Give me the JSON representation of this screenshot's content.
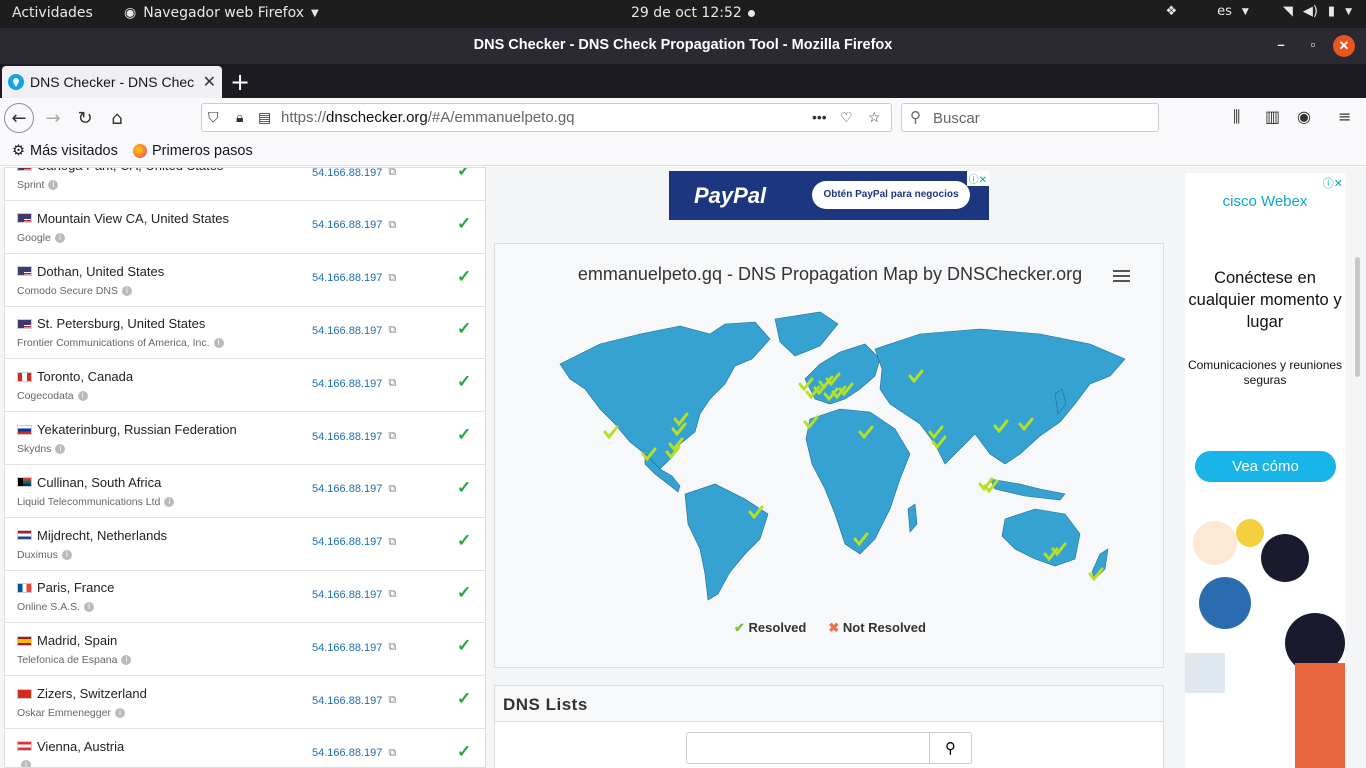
{
  "topbar": {
    "activities": "Actividades",
    "app_name": "Navegador web Firefox",
    "clock": "29 de oct  12:52",
    "lang": "es"
  },
  "window": {
    "title": "DNS Checker - DNS Check Propagation Tool - Mozilla Firefox"
  },
  "tab": {
    "label": "DNS Checker - DNS Chec"
  },
  "urlbar": {
    "prefix": "https://",
    "domain": "dnschecker.org",
    "path": "/#A/emmanuelpeto.gq"
  },
  "search": {
    "placeholder": "Buscar"
  },
  "bookmarks": {
    "most_visited": "Más visitados",
    "getting_started": "Primeros pasos"
  },
  "results": [
    {
      "location": "Canoga Park, CA, United States",
      "provider": "Sprint",
      "ip": "54.166.88.197",
      "flag": "us"
    },
    {
      "location": "Mountain View CA, United States",
      "provider": "Google",
      "ip": "54.166.88.197",
      "flag": "us"
    },
    {
      "location": "Dothan, United States",
      "provider": "Comodo Secure DNS",
      "ip": "54.166.88.197",
      "flag": "us"
    },
    {
      "location": "St. Petersburg, United States",
      "provider": "Frontier Communications of America, Inc.",
      "ip": "54.166.88.197",
      "flag": "us"
    },
    {
      "location": "Toronto, Canada",
      "provider": "Cogecodata",
      "ip": "54.166.88.197",
      "flag": "ca"
    },
    {
      "location": "Yekaterinburg, Russian Federation",
      "provider": "Skydns",
      "ip": "54.166.88.197",
      "flag": "ru"
    },
    {
      "location": "Cullinan, South Africa",
      "provider": "Liquid Telecommunications Ltd",
      "ip": "54.166.88.197",
      "flag": "za"
    },
    {
      "location": "Mijdrecht, Netherlands",
      "provider": "Duximus",
      "ip": "54.166.88.197",
      "flag": "nl"
    },
    {
      "location": "Paris, France",
      "provider": "Online S.A.S.",
      "ip": "54.166.88.197",
      "flag": "fr"
    },
    {
      "location": "Madrid, Spain",
      "provider": "Telefonica de Espana",
      "ip": "54.166.88.197",
      "flag": "es"
    },
    {
      "location": "Zizers, Switzerland",
      "provider": "Oskar Emmenegger",
      "ip": "54.166.88.197",
      "flag": "ch"
    },
    {
      "location": "Vienna, Austria",
      "provider": "",
      "ip": "54.166.88.197",
      "flag": "at"
    }
  ],
  "paypal_ad": {
    "logo": "PayPal",
    "cta": "Obtén PayPal para negocios"
  },
  "map": {
    "title": "emmanuelpeto.gq - DNS Propagation Map by DNSChecker.org",
    "legend_resolved": "Resolved",
    "legend_not_resolved": "Not Resolved",
    "colors": {
      "land": "#35a2d1",
      "ok": "#b5e024",
      "fail": "#e7744b"
    }
  },
  "dns_lists": {
    "heading": "DNS Lists"
  },
  "webex_ad": {
    "logo": "cisco Webex",
    "headline": "Conéctese en cualquier momento y lugar",
    "sub": "Comunicaciones y reuniones seguras",
    "cta": "Vea cómo"
  }
}
